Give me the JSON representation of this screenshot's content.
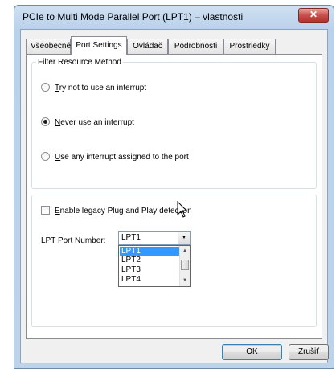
{
  "window": {
    "title": "PCIe to Multi Mode Parallel Port (LPT1) – vlastnosti",
    "close_glyph": "✕"
  },
  "tabs": [
    {
      "label": "Všeobecné"
    },
    {
      "label": "Port Settings"
    },
    {
      "label": "Ovládač"
    },
    {
      "label": "Podrobnosti"
    },
    {
      "label": "Prostriedky"
    }
  ],
  "filter": {
    "legend": "Filter Resource Method",
    "options": [
      {
        "key": "T",
        "rest": "ry not to use an interrupt",
        "checked": false
      },
      {
        "key": "N",
        "rest": "ever use an interrupt",
        "checked": true
      },
      {
        "key": "U",
        "rest": "se any interrupt assigned to the port",
        "checked": false
      }
    ]
  },
  "legacy": {
    "key": "E",
    "rest": "nable legacy Plug and Play detection",
    "checked": false
  },
  "lpt": {
    "label_pre": "LPT ",
    "label_key": "P",
    "label_post": "ort Number:",
    "selected": "LPT1",
    "options": [
      "LPT1",
      "LPT2",
      "LPT3",
      "LPT4"
    ]
  },
  "buttons": {
    "ok": "OK",
    "cancel": "Zrušiť"
  }
}
